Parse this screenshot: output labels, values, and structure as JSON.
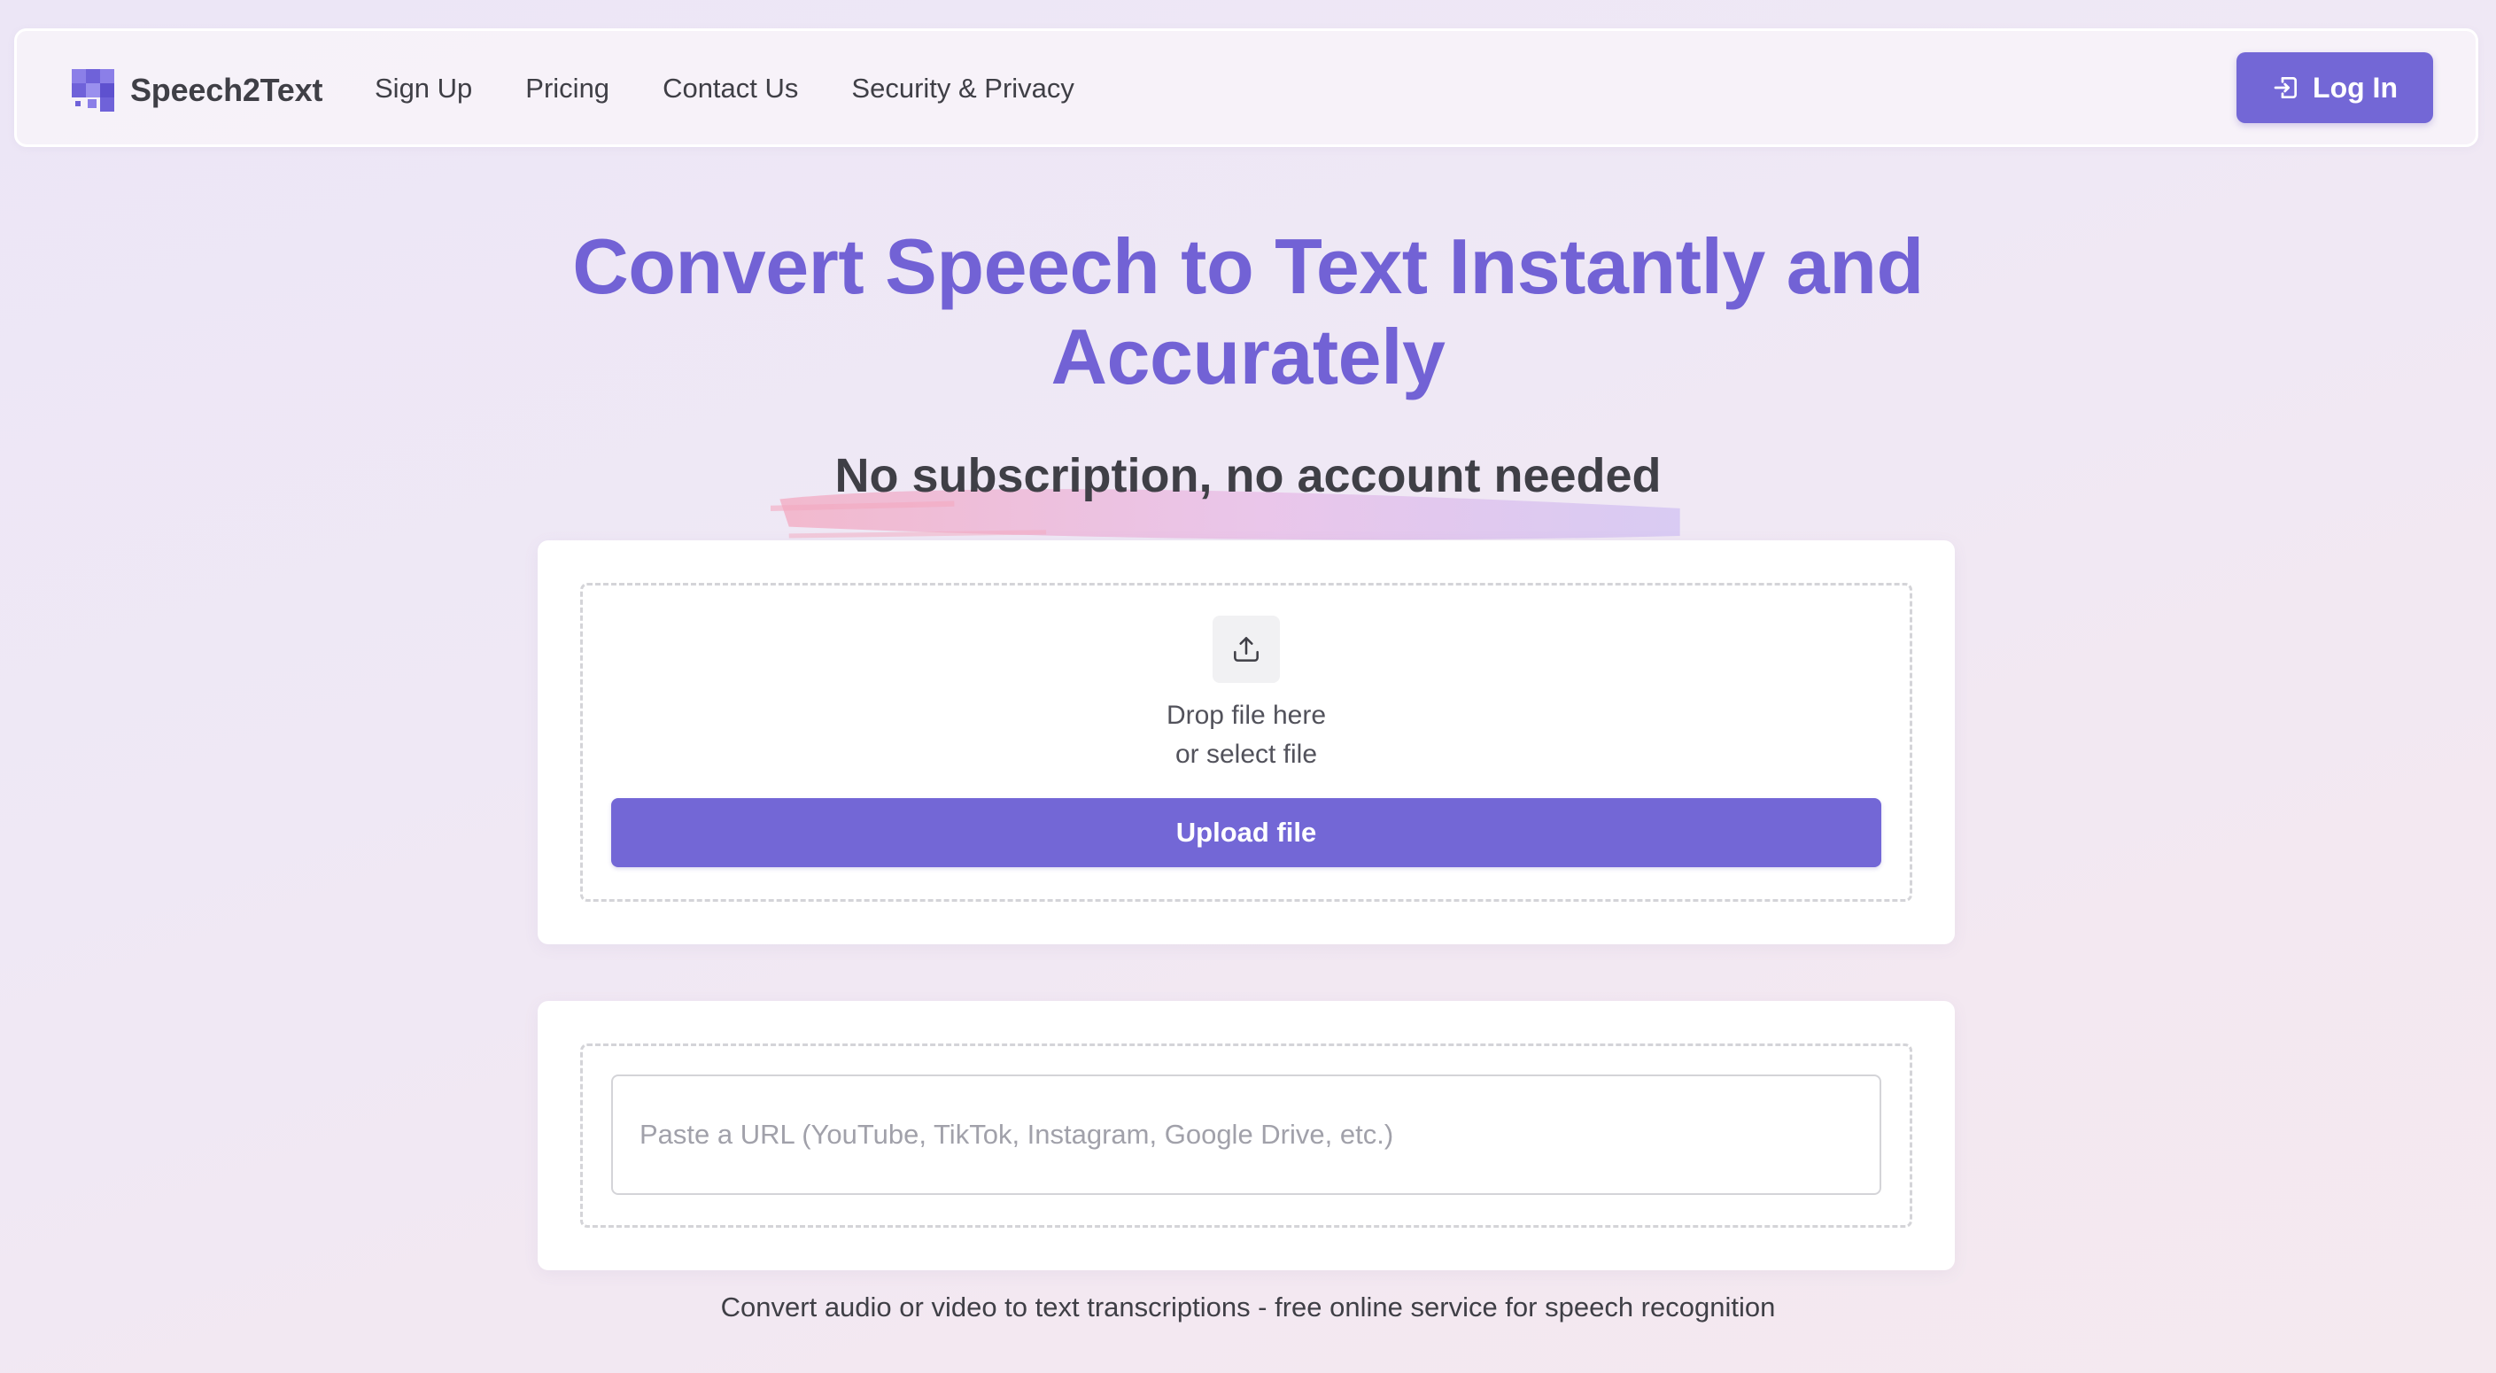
{
  "navbar": {
    "brand_name": "Speech2Text",
    "logo_icon": "grid-logo-icon",
    "links": [
      {
        "label": "Sign Up"
      },
      {
        "label": "Pricing"
      },
      {
        "label": "Contact Us"
      },
      {
        "label": "Security & Privacy"
      }
    ],
    "login_label": "Log In",
    "login_icon": "login-icon"
  },
  "hero": {
    "title_line1": "Convert Speech to Text Instantly and",
    "title_line2": "Accurately",
    "subtitle": "No subscription, no account needed"
  },
  "upload": {
    "icon": "upload-icon",
    "drop_text": "Drop file here",
    "select_text": "or select file",
    "button_label": "Upload file"
  },
  "url_input": {
    "value": "",
    "placeholder": "Paste a URL (YouTube, TikTok, Instagram, Google Drive, etc.)"
  },
  "footer": {
    "tagline": "Convert audio or video to text transcriptions - free online service for speech recognition"
  },
  "colors": {
    "accent": "#7367d6",
    "title": "#7262d5",
    "text": "#3f3f46",
    "background": "#efe8f5"
  }
}
